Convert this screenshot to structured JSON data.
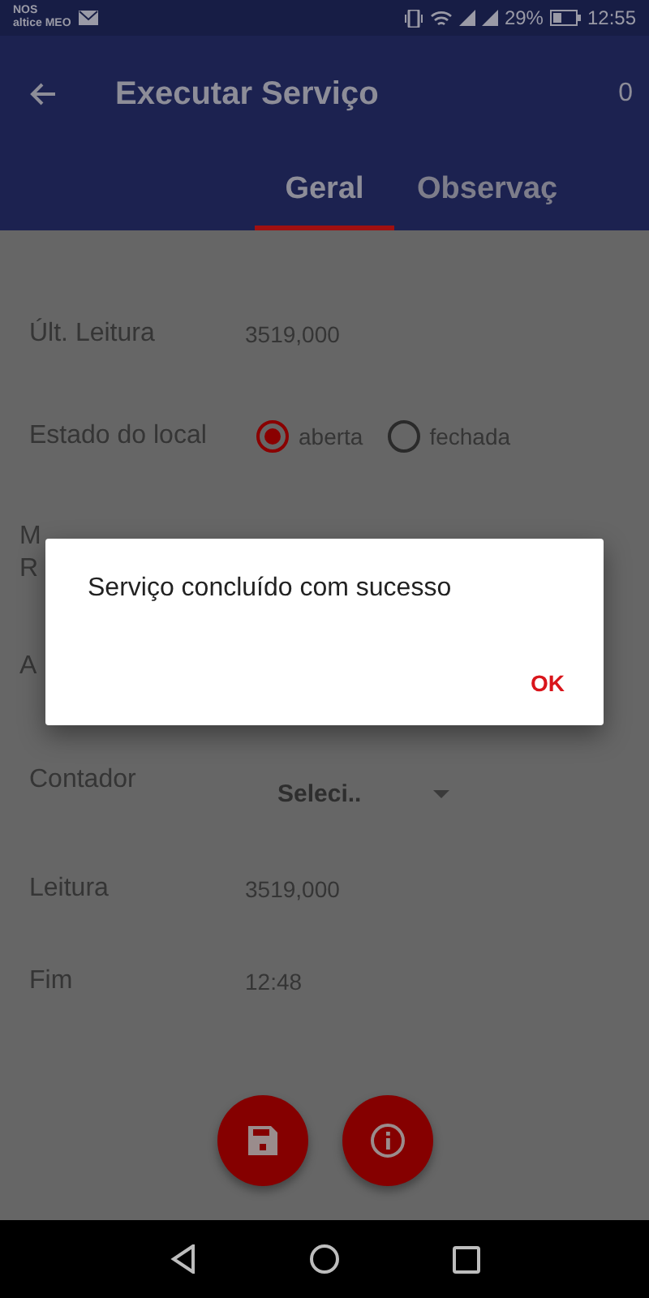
{
  "status_bar": {
    "carrier_lines": [
      "NOS",
      "altice MEO"
    ],
    "battery": "29%",
    "time": "12:55"
  },
  "app_bar": {
    "title": "Executar Serviço",
    "action": "0"
  },
  "tabs": [
    {
      "label": "Geral",
      "selected": true
    },
    {
      "label": "Observaç",
      "selected": false
    }
  ],
  "fields": [
    {
      "kind": "text",
      "label": "Últ. Leitura",
      "value": "3519,000"
    },
    {
      "kind": "radio",
      "label": "Estado do local",
      "options": [
        {
          "label": "aberta",
          "selected": true
        },
        {
          "label": "fechada",
          "selected": false
        }
      ]
    },
    {
      "kind": "covered",
      "lines": [
        "M",
        "R"
      ]
    },
    {
      "kind": "covered",
      "lines": [
        "A"
      ]
    },
    {
      "kind": "select",
      "label": "Contador",
      "value": "Seleci.."
    },
    {
      "kind": "text",
      "label": "Leitura",
      "value": "3519,000"
    },
    {
      "kind": "text",
      "label": "Fim",
      "value": "12:48"
    }
  ],
  "fab_buttons": [
    {
      "kind": "save"
    },
    {
      "kind": "info"
    }
  ],
  "dialog": {
    "message": "Serviço concluído com sucesso",
    "button": "OK"
  }
}
